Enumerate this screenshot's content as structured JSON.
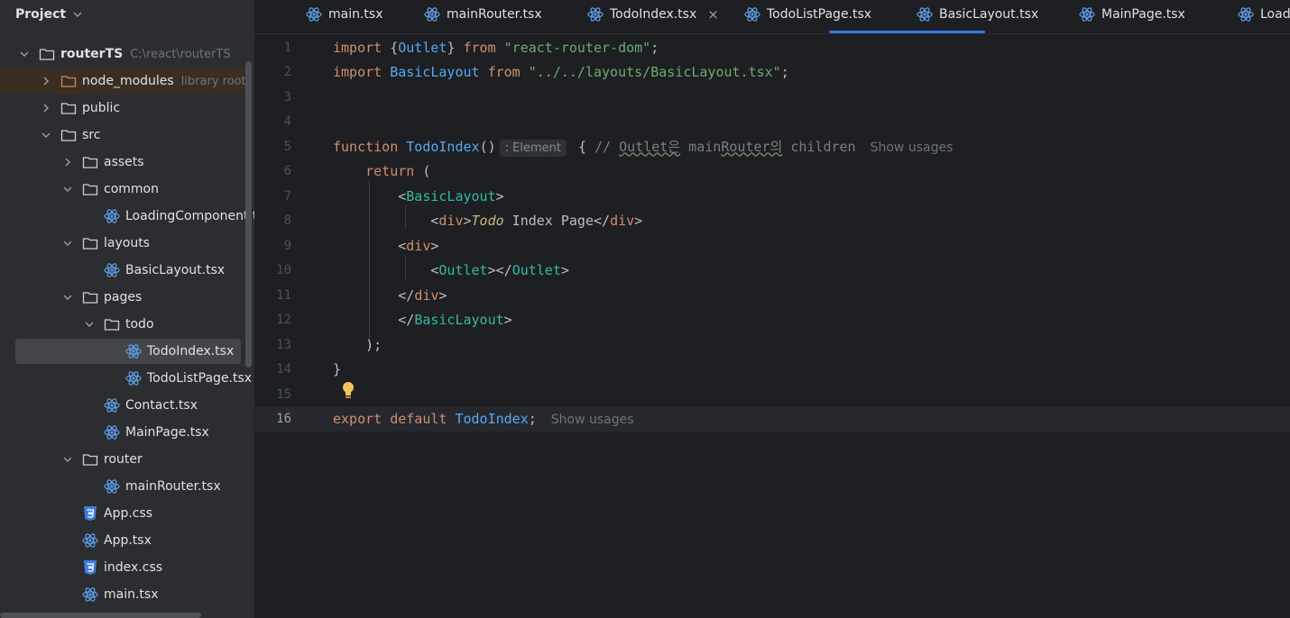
{
  "sidebar": {
    "title": "Project",
    "items": [
      {
        "label": "routerTS",
        "hint": "C:\\react\\routerTS",
        "type": "folder",
        "expanded": true,
        "level": 0,
        "bold": true
      },
      {
        "label": "node_modules",
        "hint": "library root",
        "type": "folder-lib",
        "expanded": false,
        "level": 1
      },
      {
        "label": "public",
        "type": "folder",
        "expanded": false,
        "level": 1
      },
      {
        "label": "src",
        "type": "folder",
        "expanded": true,
        "level": 1
      },
      {
        "label": "assets",
        "type": "folder",
        "expanded": false,
        "level": 2
      },
      {
        "label": "common",
        "type": "folder",
        "expanded": true,
        "level": 2
      },
      {
        "label": "LoadingComponent.tsx",
        "type": "react",
        "level": 3
      },
      {
        "label": "layouts",
        "type": "folder",
        "expanded": true,
        "level": 2
      },
      {
        "label": "BasicLayout.tsx",
        "type": "react",
        "level": 3
      },
      {
        "label": "pages",
        "type": "folder",
        "expanded": true,
        "level": 2
      },
      {
        "label": "todo",
        "type": "folder",
        "expanded": true,
        "level": 3
      },
      {
        "label": "TodoIndex.tsx",
        "type": "react",
        "level": 4,
        "selected": true
      },
      {
        "label": "TodoListPage.tsx",
        "type": "react",
        "level": 4
      },
      {
        "label": "Contact.tsx",
        "type": "react",
        "level": 3
      },
      {
        "label": "MainPage.tsx",
        "type": "react",
        "level": 3
      },
      {
        "label": "router",
        "type": "folder",
        "expanded": true,
        "level": 2
      },
      {
        "label": "mainRouter.tsx",
        "type": "react",
        "level": 3
      },
      {
        "label": "App.css",
        "type": "css",
        "level": 2
      },
      {
        "label": "App.tsx",
        "type": "react",
        "level": 2
      },
      {
        "label": "index.css",
        "type": "css",
        "level": 2
      },
      {
        "label": "main.tsx",
        "type": "react",
        "level": 2
      }
    ]
  },
  "tabs": [
    {
      "label": "main.tsx",
      "active": false
    },
    {
      "label": "mainRouter.tsx",
      "active": false
    },
    {
      "label": "TodoIndex.tsx",
      "active": true
    },
    {
      "label": "TodoListPage.tsx",
      "active": false
    },
    {
      "label": "BasicLayout.tsx",
      "active": false
    },
    {
      "label": "MainPage.tsx",
      "active": false
    },
    {
      "label": "Loadi",
      "active": false
    }
  ],
  "editor": {
    "current_line": 16,
    "inlay_hint": ": Element",
    "show_usages": "Show usages",
    "lines": [
      {
        "n": "1",
        "parts": [
          [
            "kw",
            "import "
          ],
          [
            "p",
            "{"
          ],
          [
            "fn",
            "Outlet"
          ],
          [
            "p",
            "} "
          ],
          [
            "kw",
            "from "
          ],
          [
            "str",
            "\"react-router-dom\""
          ],
          [
            "p",
            ";"
          ]
        ]
      },
      {
        "n": "2",
        "parts": [
          [
            "kw",
            "import "
          ],
          [
            "fn",
            "BasicLayout "
          ],
          [
            "kw",
            "from "
          ],
          [
            "str",
            "\"../../layouts/BasicLayout.tsx\""
          ],
          [
            "p",
            ";"
          ]
        ]
      },
      {
        "n": "3",
        "parts": []
      },
      {
        "n": "4",
        "parts": []
      },
      {
        "n": "5",
        "parts": [
          [
            "kw",
            "function "
          ],
          [
            "fn",
            "TodoIndex"
          ],
          [
            "p",
            "()"
          ],
          [
            "inlay",
            ""
          ],
          [
            "p",
            " { "
          ],
          [
            "cmt",
            "// "
          ],
          [
            "cmtw",
            "Outlet은"
          ],
          [
            "cmt",
            " main"
          ],
          [
            "cmtw",
            "Router의"
          ],
          [
            "cmt",
            " children"
          ],
          [
            "usages",
            ""
          ]
        ]
      },
      {
        "n": "6",
        "parts": [
          [
            "p",
            "    "
          ],
          [
            "kw",
            "return "
          ],
          [
            "p",
            "("
          ]
        ]
      },
      {
        "n": "7",
        "parts": [
          [
            "p",
            "        <"
          ],
          [
            "tag",
            "BasicLayout"
          ],
          [
            "p",
            ">"
          ]
        ]
      },
      {
        "n": "8",
        "parts": [
          [
            "p",
            "            <"
          ],
          [
            "kw",
            "div"
          ],
          [
            "p",
            ">"
          ],
          [
            "ital",
            "Todo"
          ],
          [
            "p",
            " Index Page</"
          ],
          [
            "kw",
            "div"
          ],
          [
            "p",
            ">"
          ]
        ]
      },
      {
        "n": "9",
        "parts": [
          [
            "p",
            "        <"
          ],
          [
            "kw",
            "div"
          ],
          [
            "p",
            ">"
          ]
        ]
      },
      {
        "n": "10",
        "parts": [
          [
            "p",
            "            <"
          ],
          [
            "tag",
            "Outlet"
          ],
          [
            "p",
            "></"
          ],
          [
            "tag",
            "Outlet"
          ],
          [
            "p",
            ">"
          ]
        ]
      },
      {
        "n": "11",
        "parts": [
          [
            "p",
            "        </"
          ],
          [
            "kw",
            "div"
          ],
          [
            "p",
            ">"
          ]
        ]
      },
      {
        "n": "12",
        "parts": [
          [
            "p",
            "        </"
          ],
          [
            "tag",
            "BasicLayout"
          ],
          [
            "p",
            ">"
          ]
        ]
      },
      {
        "n": "13",
        "parts": [
          [
            "p",
            "    );"
          ]
        ]
      },
      {
        "n": "14",
        "parts": [
          [
            "p",
            "}"
          ]
        ]
      },
      {
        "n": "15",
        "parts": []
      },
      {
        "n": "16",
        "parts": [
          [
            "kw",
            "export "
          ],
          [
            "kw",
            "default "
          ],
          [
            "fn",
            "TodoIndex"
          ],
          [
            "p",
            ";"
          ],
          [
            "usages",
            ""
          ]
        ]
      }
    ]
  }
}
